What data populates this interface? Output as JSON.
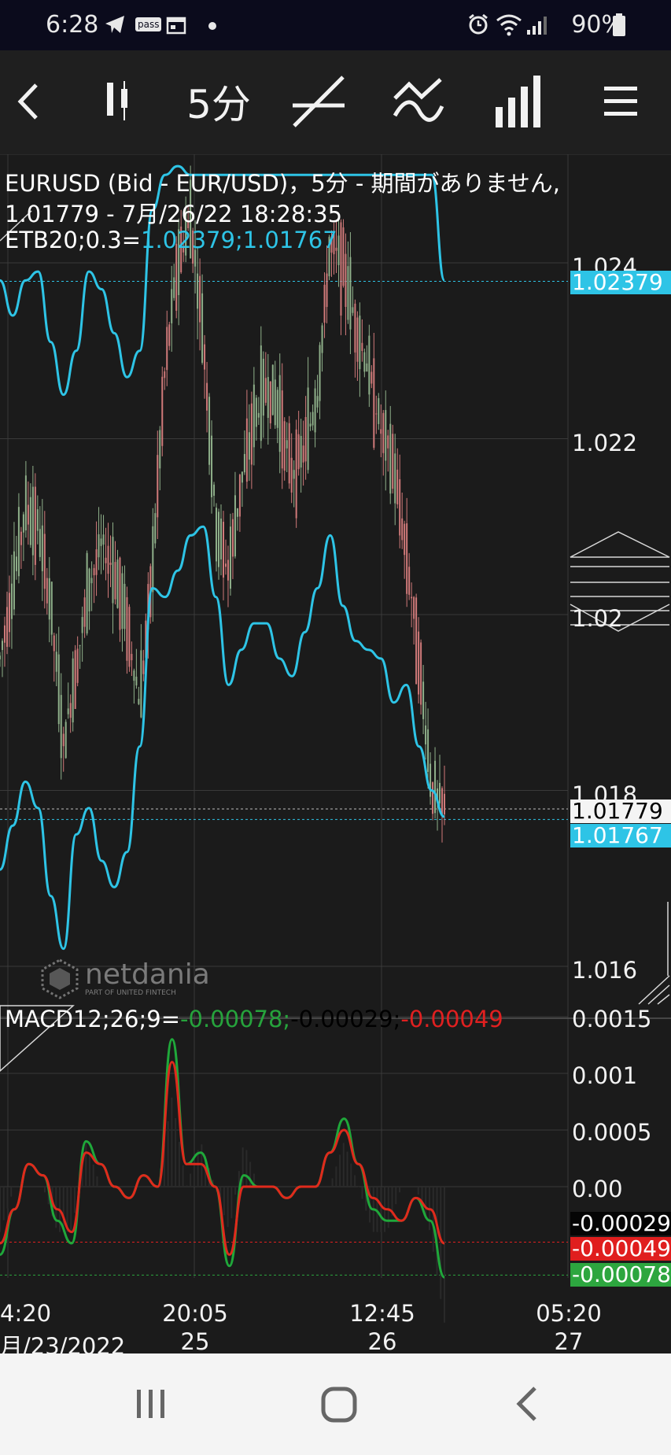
{
  "status_bar": {
    "time": "6:28",
    "pass_label": "pass",
    "battery": "90%"
  },
  "toolbar": {
    "timeframe_label": "5分",
    "icons": [
      "back-icon",
      "candlestick-icon",
      "drawing-line-icon",
      "indicator-icon",
      "volume-bars-icon",
      "menu-icon"
    ]
  },
  "chart_info": {
    "line1": "EURUSD (Bid - EUR/USD)，5分 - 期間がありません,",
    "line2": "1.01779 - 7月/26/22 18:28:35",
    "etb_label": "ETB20;0.3=",
    "etb_values": "1.02379;1.01767"
  },
  "watermark": {
    "brand": "netdania",
    "sub": "PART OF UNITED FINTECH"
  },
  "price_axis": {
    "ticks": [
      "1.024",
      "1.022",
      "1.02",
      "1.018",
      "1.016"
    ],
    "tags": {
      "upper_band": "1.02379",
      "last_price": "1.01779",
      "lower_band": "1.01767"
    }
  },
  "macd_info": {
    "label": "MACD12;26;9=",
    "macd": "-0.00078;",
    "signal": "-0.00029;",
    "hist": "-0.00049"
  },
  "macd_axis": {
    "ticks": [
      "0.0015",
      "0.001",
      "0.0005",
      "0.00"
    ],
    "tags": {
      "signal": "-0.00029",
      "histogram": "-0.00049",
      "macd": "-0.00078"
    }
  },
  "time_axis": {
    "times": [
      "4:20",
      "20:05",
      "12:45",
      "05:20"
    ],
    "dates": [
      "月/23/2022",
      "25",
      "26",
      "27"
    ]
  },
  "colors": {
    "background": "#1b1b1b",
    "band": "#2ec4e6",
    "candle_up": "#8fb08a",
    "candle_down": "#d07a7a",
    "macd_line": "#1fa83a",
    "signal_line": "#e02a1c"
  },
  "chart_data": [
    {
      "type": "line",
      "title": "EURUSD (Bid - EUR/USD)，5分",
      "ylim": [
        1.0153,
        1.0255
      ],
      "x_ticks": [
        "4:20 月/23/2022",
        "20:05 25",
        "12:45 26",
        "05:20 27"
      ],
      "series": [
        {
          "name": "EURUSD",
          "values": [
            1.0195,
            1.0203,
            1.0212,
            1.021,
            1.0201,
            1.0185,
            1.0194,
            1.0203,
            1.0208,
            1.0205,
            1.0199,
            1.019,
            1.0205,
            1.0228,
            1.024,
            1.0245,
            1.0232,
            1.021,
            1.0205,
            1.0215,
            1.0222,
            1.0226,
            1.0223,
            1.0216,
            1.0219,
            1.0225,
            1.0242,
            1.024,
            1.0233,
            1.0228,
            1.0221,
            1.0217,
            1.0207,
            1.0195,
            1.018,
            1.0178
          ]
        },
        {
          "name": "ETB20 upper",
          "values": [
            1.0238,
            1.0234,
            1.0238,
            1.0239,
            1.0231,
            1.0225,
            1.023,
            1.0239,
            1.0237,
            1.0232,
            1.0227,
            1.023,
            1.0246,
            1.025,
            1.0251,
            1.025,
            1.025,
            1.025,
            1.025,
            1.025,
            1.025,
            1.025,
            1.025,
            1.025,
            1.025,
            1.025,
            1.025,
            1.025,
            1.025,
            1.025,
            1.025,
            1.025,
            1.025,
            1.025,
            1.025,
            1.0238
          ]
        },
        {
          "name": "ETB20 lower",
          "values": [
            1.0171,
            1.0176,
            1.0181,
            1.0178,
            1.0168,
            1.0162,
            1.0175,
            1.0178,
            1.0172,
            1.0169,
            1.0173,
            1.0185,
            1.0203,
            1.0202,
            1.0205,
            1.0209,
            1.021,
            1.0202,
            1.0192,
            1.0196,
            1.0199,
            1.0199,
            1.0195,
            1.0193,
            1.0198,
            1.0203,
            1.0209,
            1.0201,
            1.0197,
            1.0196,
            1.0195,
            1.019,
            1.0192,
            1.0185,
            1.018,
            1.0177
          ]
        }
      ]
    },
    {
      "type": "line",
      "title": "MACD12;26;9",
      "ylim": [
        -0.0008,
        0.0015
      ],
      "series": [
        {
          "name": "MACD",
          "values": [
            -0.0006,
            -0.0002,
            0.0002,
            0.0001,
            -0.0003,
            -0.0005,
            0.0004,
            0.0002,
            0.0,
            -0.0001,
            0.0001,
            0.0,
            0.0013,
            0.0002,
            0.0003,
            0.0,
            -0.0007,
            0.0001,
            0.0,
            0.0,
            -0.0001,
            0.0,
            0.0,
            0.0003,
            0.0006,
            0.0002,
            -0.0002,
            -0.0003,
            -0.0003,
            -0.0001,
            -0.0003,
            -0.0008
          ]
        },
        {
          "name": "Signal",
          "values": [
            -0.0005,
            -0.0002,
            0.0002,
            0.0001,
            -0.0002,
            -0.0004,
            0.0003,
            0.0002,
            0.0,
            -0.0001,
            0.0001,
            0.0,
            0.0011,
            0.0002,
            0.0002,
            0.0,
            -0.0006,
            0.0,
            0.0,
            0.0,
            -0.0001,
            0.0,
            0.0,
            0.0003,
            0.0005,
            0.0002,
            -0.0001,
            -0.0002,
            -0.0003,
            -0.0001,
            -0.0002,
            -0.0005
          ]
        }
      ]
    }
  ]
}
